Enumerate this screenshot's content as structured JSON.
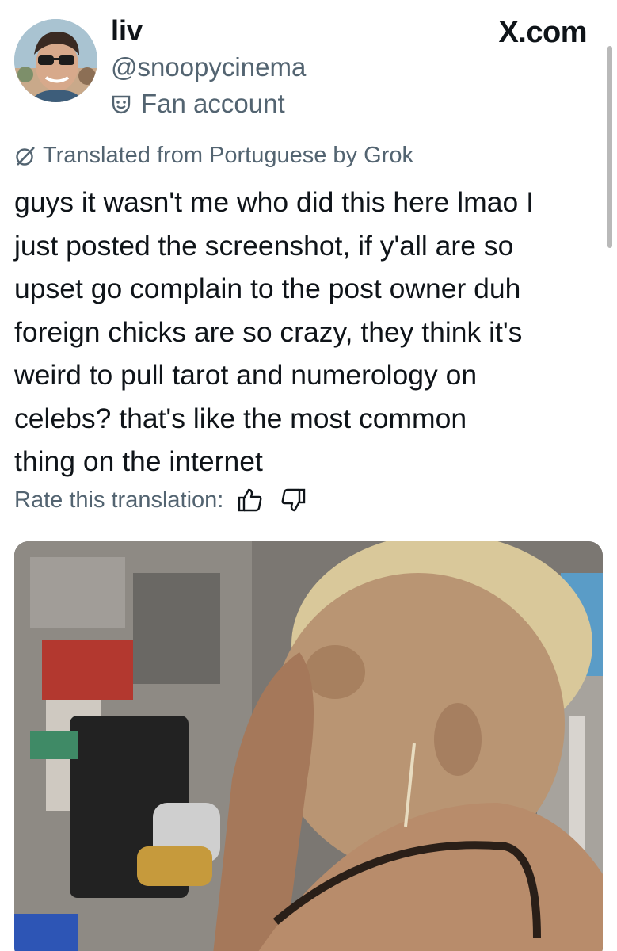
{
  "header": {
    "display_name": "liv",
    "handle": "@snoopycinema",
    "label": "Fan account",
    "label_icon": "theater-mask-icon",
    "brand": "X.com"
  },
  "translation": {
    "notice": "Translated from Portuguese by Grok",
    "notice_icon": "grok-icon",
    "rate_prompt": "Rate this translation:",
    "thumbs_up_icon": "thumbs-up-icon",
    "thumbs_down_icon": "thumbs-down-icon"
  },
  "post": {
    "text": "guys it wasn't me who did this here lmao I\njust posted the screenshot, if y'all are so\nupset go complain to the post owner duh\nforeign chicks are so crazy, they think it's\nweird to pull tarot and numerology on\ncelebs? that's like the most common\nthing on the internet"
  },
  "colors": {
    "text_primary": "#0f1419",
    "text_secondary": "#536471",
    "background": "#ffffff"
  }
}
